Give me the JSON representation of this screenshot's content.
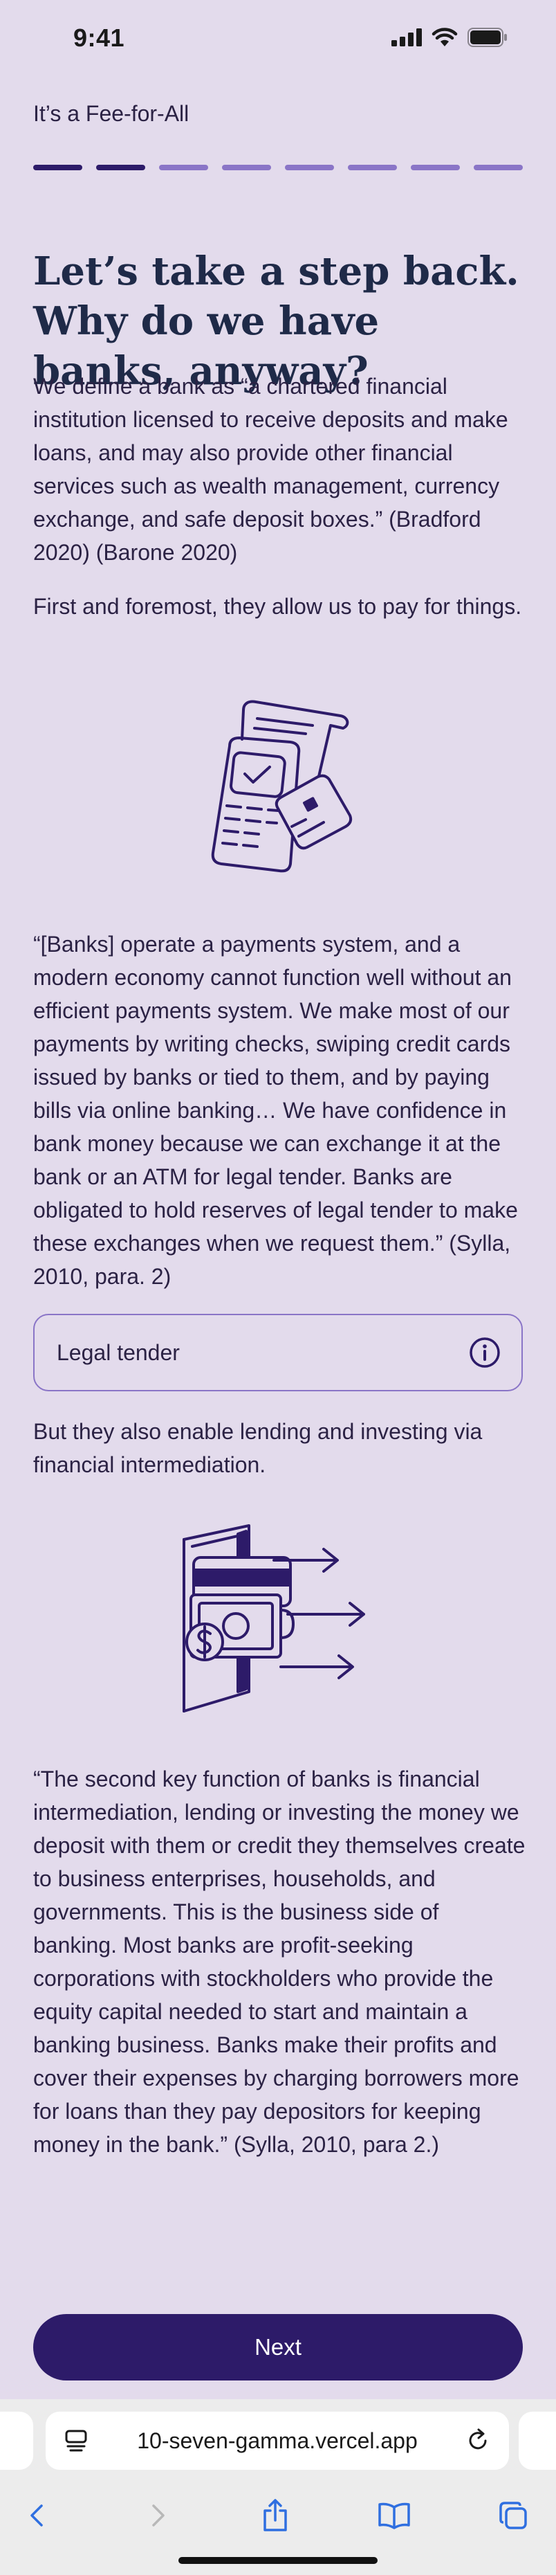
{
  "status": {
    "time": "9:41"
  },
  "section_label": "It’s a Fee-for-All",
  "progress": {
    "total_steps": 8,
    "completed_steps": 2
  },
  "title": "Let’s take a step back. Why do we have banks, anyway?",
  "paragraphs": {
    "definition": "We define a bank as “a chartered financial institution licensed to receive deposits and make loans, and may also provide other financial services such as wealth management, currency exchange, and safe deposit boxes.” (Bradford 2020) (Barone 2020)",
    "payments_intro": "First and foremost, they allow us to pay for things.",
    "payments_quote": "“[Banks] operate a payments system, and a modern economy cannot function well without an efficient payments system. We make most of our payments by writing checks, swiping credit cards issued by banks or tied to them, and by paying bills via online banking… We have confidence in bank money because we can exchange it at the bank or an ATM for legal tender. Banks are obligated to hold reserves of legal tender to make these exchanges when we request them.” (Sylla, 2010, para. 2)",
    "lending_intro": "But they also enable lending and investing via financial intermediation.",
    "lending_quote": "“The second key function of banks is financial intermediation, lending or investing the money we deposit with them or credit they themselves create to business enterprises, households, and governments. This is the business side of banking. Most banks are profit-seeking corporations with stockholders who provide the equity capital needed to start and maintain a banking business. Banks make their profits and cover their expenses by charging borrowers more for loans than they pay depositors for keeping money in the bank.” (Sylla, 2010, para 2.)"
  },
  "glossary": {
    "label": "Legal tender",
    "icon": "info-icon"
  },
  "next_button": {
    "label": "Next"
  },
  "browser": {
    "url": "10-seven-gamma.vercel.app"
  },
  "colors": {
    "background": "#e3dbec",
    "accent": "#2d1b69",
    "progress_todo": "#8a75c7",
    "title": "#1f2a48"
  }
}
